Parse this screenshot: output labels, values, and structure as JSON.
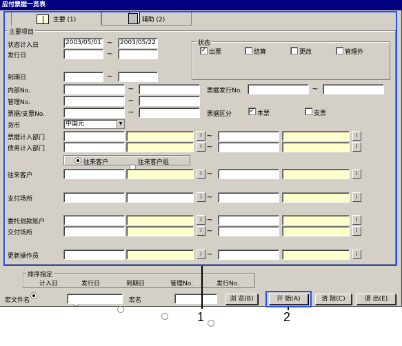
{
  "window": {
    "title": "应付票据一览表"
  },
  "tabs": [
    {
      "label": "主要 (1)"
    },
    {
      "label": "辅助 (2)"
    }
  ],
  "main_group": {
    "label": "主要项目"
  },
  "fields": {
    "status_date": {
      "label": "状态计入日",
      "from": "2003/05/01",
      "to": "2003/05/22"
    },
    "issue_date": {
      "label": "发行日"
    },
    "due_date": {
      "label": "到期日"
    },
    "internal_no": {
      "label": "内部No."
    },
    "mgmt_no": {
      "label": "管理No."
    },
    "bill_no": {
      "label": "票据/支票No."
    },
    "currency": {
      "label": "货币",
      "value": "中国元"
    },
    "bill_dept": {
      "label": "票据计入部门"
    },
    "debt_dept": {
      "label": "债务计入部门"
    },
    "partner": {
      "label": "往来客户"
    },
    "pay_place": {
      "label": "支付场所"
    },
    "trust_account": {
      "label": "委托划款账户"
    },
    "deliver_place": {
      "label": "交付场所"
    },
    "updater": {
      "label": "更新操作员"
    },
    "bill_issue_no": {
      "label": "票据发行No."
    },
    "bill_type": {
      "label": "票据区分"
    }
  },
  "status_group": {
    "label": "状态",
    "items": [
      {
        "label": "出票",
        "checked": "✓"
      },
      {
        "label": "结算",
        "checked": ""
      },
      {
        "label": "更改",
        "checked": ""
      },
      {
        "label": "管理外",
        "checked": ""
      }
    ]
  },
  "bill_type_items": [
    {
      "label": "本票",
      "checked": "✓"
    },
    {
      "label": "支票",
      "checked": ""
    }
  ],
  "partner_radio": [
    {
      "label": "往来客户",
      "selected": true
    },
    {
      "label": "往来客户组",
      "selected": false
    }
  ],
  "sort_group": {
    "label": "排序指定",
    "options": [
      {
        "label": "计入日",
        "selected": true
      },
      {
        "label": "发行日",
        "selected": false
      },
      {
        "label": "到期日",
        "selected": false
      },
      {
        "label": "管理No.",
        "selected": false
      },
      {
        "label": "发行No.",
        "selected": false
      }
    ]
  },
  "bottom": {
    "macro_file_label": "宏文件名",
    "macro_name_label": "宏名",
    "browse_button": "浏 览(B)",
    "start_button": "开 始(A)",
    "clear_button": "清 除(C)",
    "exit_button": "退 出(E)"
  },
  "lookup_button": "i",
  "tilde": "~",
  "callouts": [
    "1",
    "2"
  ],
  "colors": {
    "highlight": "#2050ff",
    "title_bar": "#000080",
    "yellow_field": "#ffffcc"
  }
}
